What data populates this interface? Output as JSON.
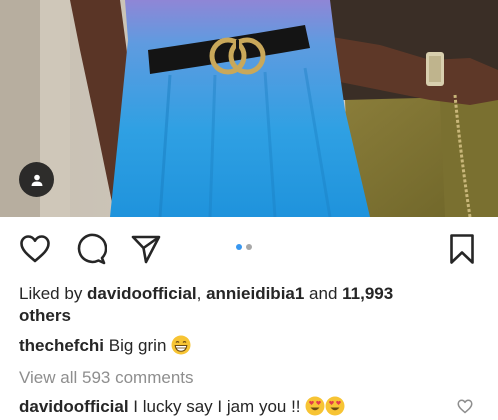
{
  "post": {
    "liked_by_prefix": "Liked by ",
    "liked_user1": "davidoofficial",
    "liked_sep": ", ",
    "liked_user2": "annieidibia1",
    "liked_and": " and ",
    "liked_count": "11,993",
    "liked_others": "others",
    "caption_user": "thechefchi",
    "caption_text": " Big grin ",
    "view_comments": "View all 593 comments",
    "comment_user": "davidoofficial",
    "comment_text": " I lucky say I jam you !! "
  },
  "carousel": {
    "count": 2,
    "active_index": 0
  },
  "icons": {
    "like": "heart-icon",
    "comment": "comment-icon",
    "share": "paper-plane-icon",
    "save": "bookmark-icon",
    "tag": "user-tag-icon"
  },
  "colors": {
    "active_dot": "#3897f0",
    "inactive_dot": "#a8a8a8",
    "muted_text": "#8e8e8e",
    "text": "#262626"
  }
}
